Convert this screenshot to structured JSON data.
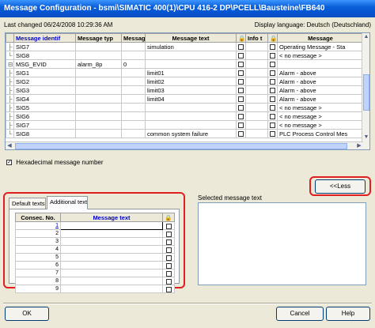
{
  "window": {
    "title": "Message Configuration - bsmi\\SIMATIC 400(1)\\CPU 416-2 DP\\PCELL\\Bausteine\\FB640"
  },
  "info": {
    "last_changed": "Last changed 06/24/2008 10:29:36 AM",
    "display_language": "Display language: Deutsch (Deutschland)"
  },
  "grid": {
    "columns": [
      "Message identif",
      "Message typ",
      "Messag",
      "Message text",
      "",
      "Info t",
      "",
      "Message"
    ],
    "rows": [
      {
        "tree": "├",
        "id": "SIG7",
        "type": "",
        "num": "",
        "text": "simulation",
        "c1": "",
        "info": "",
        "c2": "",
        "msg": "Operating Message - Sta"
      },
      {
        "tree": "└",
        "id": "SIG8",
        "type": "",
        "num": "",
        "text": "",
        "c1": "",
        "info": "",
        "c2": "",
        "msg": "< no message >"
      },
      {
        "tree": "⊟",
        "id": "MSG_EVID",
        "type": "alarm_8p",
        "num": "0",
        "text": "",
        "c1": "",
        "info": "",
        "c2": "",
        "msg": ""
      },
      {
        "tree": "├",
        "id": "SIG1",
        "type": "",
        "num": "",
        "text": "limit01",
        "c1": "",
        "info": "",
        "c2": "",
        "msg": "Alarm - above"
      },
      {
        "tree": "├",
        "id": "SIG2",
        "type": "",
        "num": "",
        "text": "limit02",
        "c1": "",
        "info": "",
        "c2": "",
        "msg": "Alarm - above"
      },
      {
        "tree": "├",
        "id": "SIG3",
        "type": "",
        "num": "",
        "text": "limit03",
        "c1": "",
        "info": "",
        "c2": "",
        "msg": "Alarm - above"
      },
      {
        "tree": "├",
        "id": "SIG4",
        "type": "",
        "num": "",
        "text": "limit04",
        "c1": "",
        "info": "",
        "c2": "",
        "msg": "Alarm - above"
      },
      {
        "tree": "├",
        "id": "SIG5",
        "type": "",
        "num": "",
        "text": "",
        "c1": "",
        "info": "",
        "c2": "",
        "msg": "< no message >"
      },
      {
        "tree": "├",
        "id": "SIG6",
        "type": "",
        "num": "",
        "text": "",
        "c1": "",
        "info": "",
        "c2": "",
        "msg": "< no message >"
      },
      {
        "tree": "├",
        "id": "SIG7",
        "type": "",
        "num": "",
        "text": "",
        "c1": "",
        "info": "",
        "c2": "",
        "msg": "< no message >"
      },
      {
        "tree": "└",
        "id": "SIG8",
        "type": "",
        "num": "",
        "text": "common system failure",
        "c1": "",
        "info": "",
        "c2": "",
        "msg": "PLC Process Control Mes"
      }
    ]
  },
  "hex": {
    "label": "Hexadecimal message number",
    "checked": true
  },
  "less_button": "<<Less",
  "tabs": [
    "Default texts",
    "Additional text"
  ],
  "additional": {
    "columns": [
      "Consec. No.",
      "Message text",
      ""
    ],
    "rows": [
      "1",
      "2",
      "3",
      "4",
      "5",
      "6",
      "7",
      "8",
      "9"
    ]
  },
  "selected_label": "Selected message text",
  "buttons": {
    "ok": "OK",
    "cancel": "Cancel",
    "help": "Help"
  }
}
